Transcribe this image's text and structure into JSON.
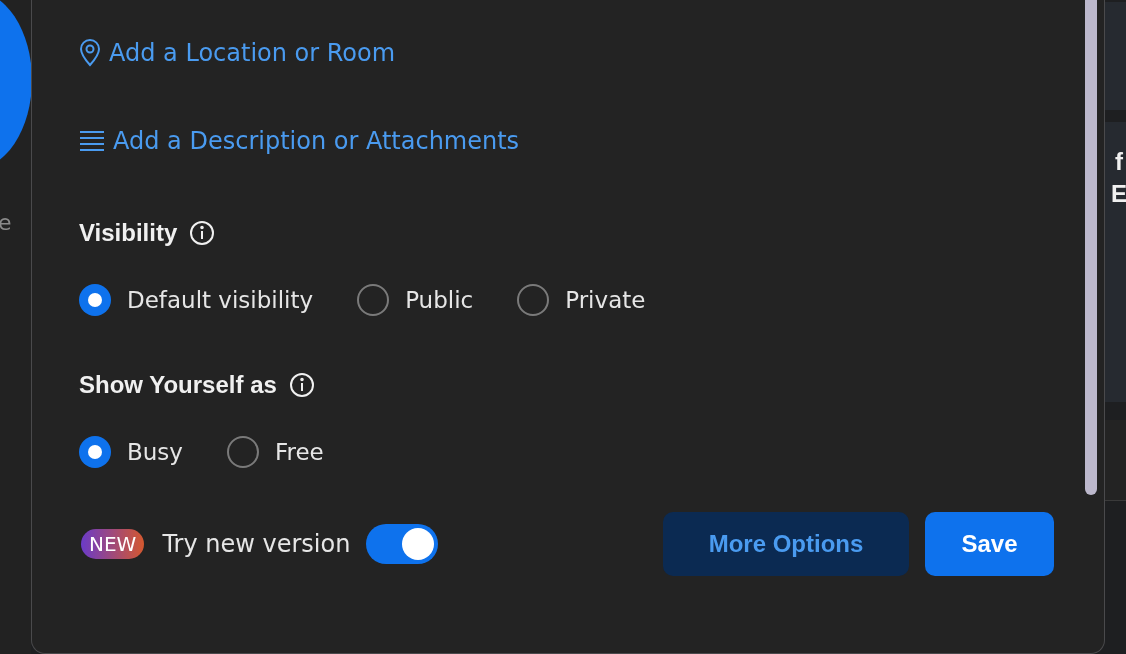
{
  "background": {
    "left_text": "e",
    "right_texts": [
      "f",
      "E"
    ]
  },
  "links": [
    {
      "kind": "location",
      "label": "Add a Location or Room"
    },
    {
      "kind": "description",
      "label": "Add a Description or Attachments"
    }
  ],
  "groups": [
    {
      "title": "Visibility",
      "options": [
        {
          "label": "Default visibility",
          "selected": true
        },
        {
          "label": "Public",
          "selected": false
        },
        {
          "label": "Private",
          "selected": false
        }
      ]
    },
    {
      "title": "Show Yourself as",
      "options": [
        {
          "label": "Busy",
          "selected": true
        },
        {
          "label": "Free",
          "selected": false
        }
      ]
    }
  ],
  "footer": {
    "badge": "NEW",
    "toggle_label": "Try new version",
    "toggle_on": true,
    "buttons": [
      {
        "kind": "secondary",
        "label": "More Options"
      },
      {
        "kind": "primary",
        "label": "Save"
      }
    ]
  }
}
